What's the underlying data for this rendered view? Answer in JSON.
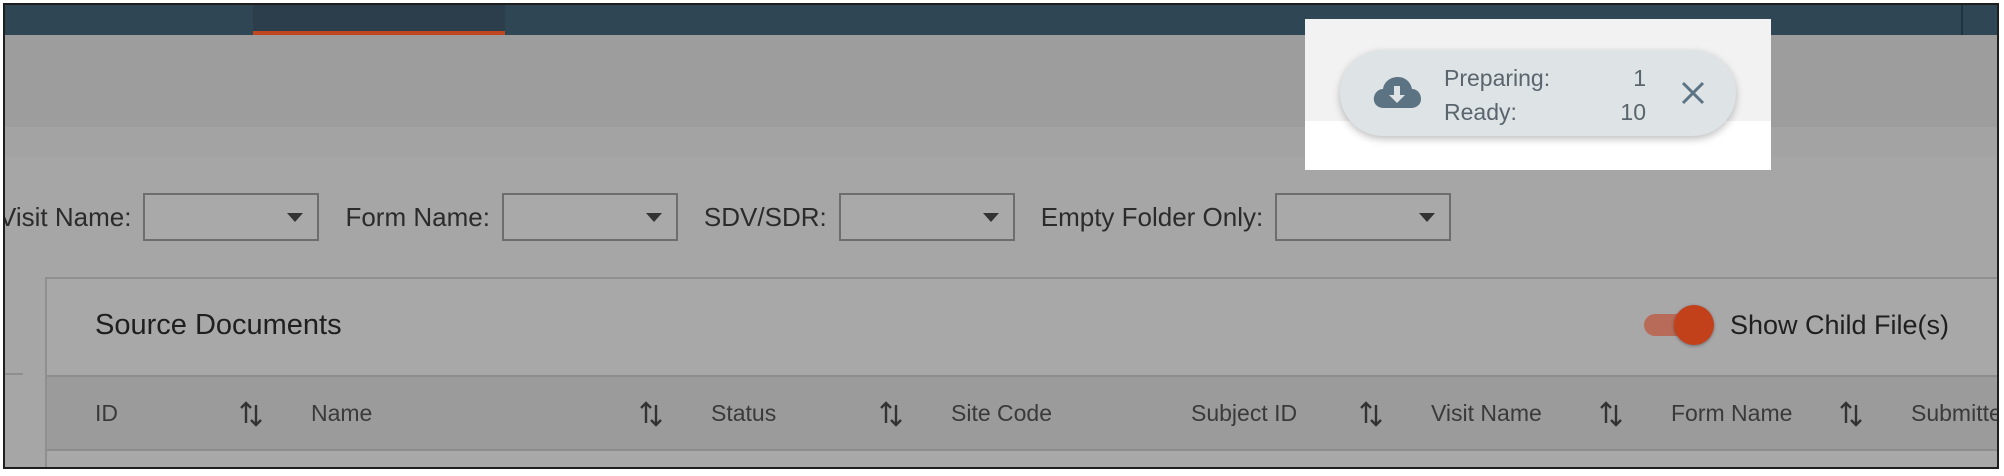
{
  "filters": [
    {
      "label": "Visit Name:",
      "value": ""
    },
    {
      "label": "Form Name:",
      "value": ""
    },
    {
      "label": "SDV/SDR:",
      "value": ""
    },
    {
      "label": "Empty Folder Only:",
      "value": ""
    }
  ],
  "panel": {
    "title": "Source Documents",
    "toggle_label": "Show Child File(s)",
    "toggle_on": true
  },
  "table": {
    "columns": [
      "ID",
      "Name",
      "Status",
      "Site Code",
      "Subject ID",
      "Visit Name",
      "Form Name",
      "Submitte"
    ]
  },
  "toast": {
    "preparing_label": "Preparing:",
    "preparing_count": "1",
    "ready_label": "Ready:",
    "ready_count": "10",
    "icon": "cloud-download-icon"
  },
  "colors": {
    "topbar": "#2f4654",
    "accent": "#c2401a",
    "toast_bg": "#dee3e6",
    "toast_icon": "#5b7382"
  }
}
